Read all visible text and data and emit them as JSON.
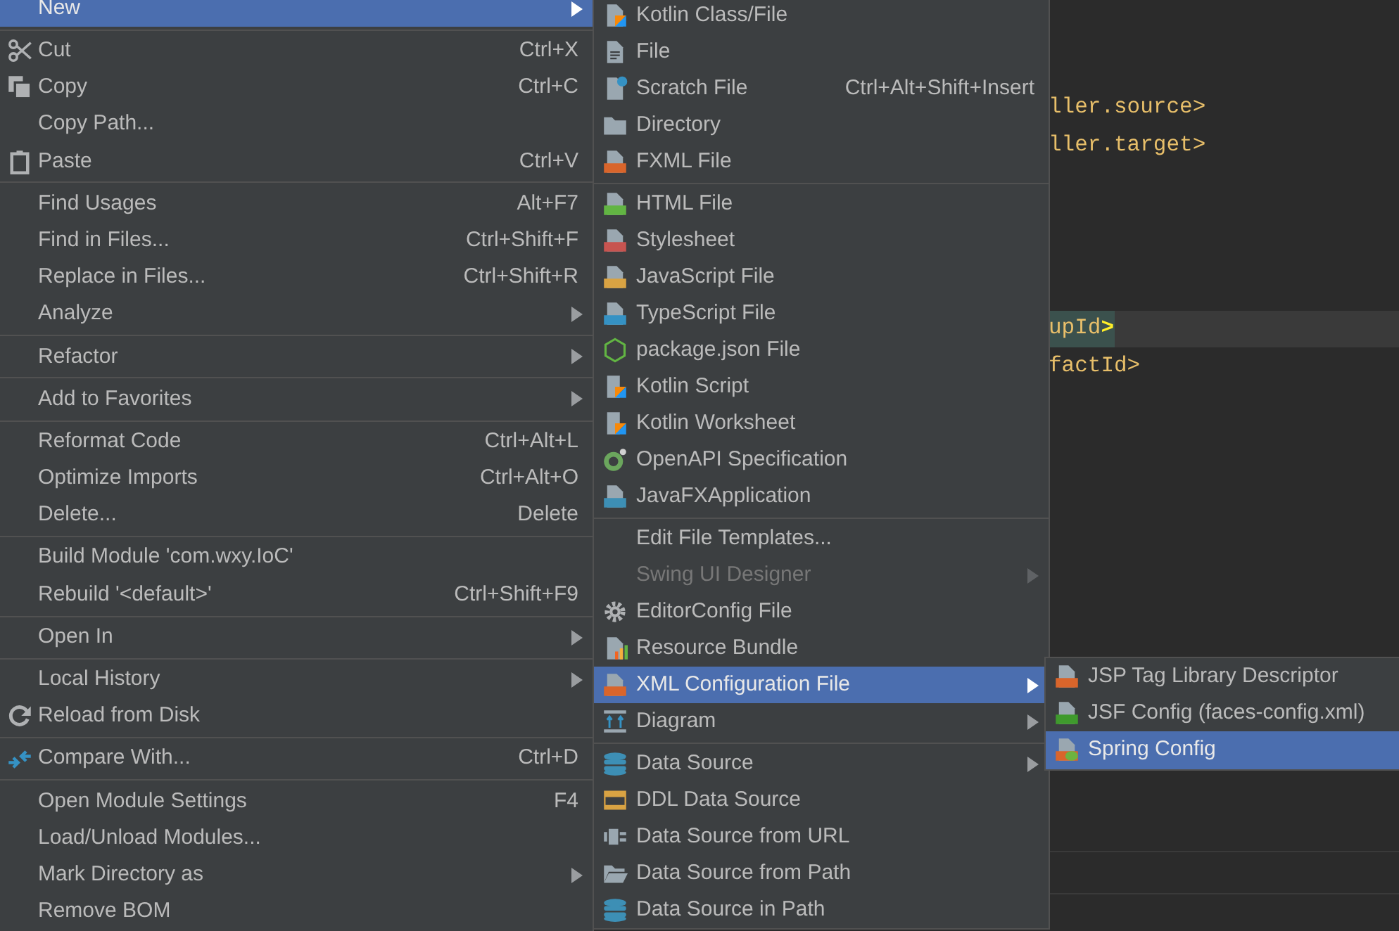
{
  "editor": {
    "blocks": [
      {
        "lines": [
          {
            "segments": [
              {
                "text": "ller.source>",
                "kind": "tag"
              }
            ]
          },
          {
            "segments": [
              {
                "text": "ller.target>",
                "kind": "tag"
              }
            ]
          }
        ]
      },
      {
        "lines": [
          {
            "current": true,
            "segments": [
              {
                "text": "upId",
                "kind": "highlighted-tag"
              },
              {
                "text": ">",
                "kind": "brace"
              }
            ]
          },
          {
            "current": false,
            "segments": [
              {
                "text": "factId>",
                "kind": "tag"
              }
            ]
          }
        ]
      }
    ]
  },
  "left_menu": {
    "groups": [
      [
        {
          "label": "New",
          "submenu": true,
          "selected": true
        }
      ],
      [
        {
          "label": "Cut",
          "shortcut": "Ctrl+X",
          "selected": false
        },
        {
          "label": "Copy",
          "shortcut": "Ctrl+C",
          "selected": false
        },
        {
          "label": "Copy Path...",
          "selected": false
        },
        {
          "label": "Paste",
          "shortcut": "Ctrl+V",
          "selected": false
        }
      ],
      [
        {
          "label": "Find Usages",
          "shortcut": "Alt+F7",
          "selected": false
        },
        {
          "label": "Find in Files...",
          "shortcut": "Ctrl+Shift+F",
          "selected": false
        },
        {
          "label": "Replace in Files...",
          "shortcut": "Ctrl+Shift+R",
          "selected": false
        },
        {
          "label": "Analyze",
          "submenu": true,
          "selected": false
        }
      ],
      [
        {
          "label": "Refactor",
          "submenu": true,
          "selected": false
        }
      ],
      [
        {
          "label": "Add to Favorites",
          "submenu": true,
          "selected": false
        }
      ],
      [
        {
          "label": "Reformat Code",
          "shortcut": "Ctrl+Alt+L",
          "selected": false
        },
        {
          "label": "Optimize Imports",
          "shortcut": "Ctrl+Alt+O",
          "selected": false
        },
        {
          "label": "Delete...",
          "shortcut": "Delete",
          "selected": false
        }
      ],
      [
        {
          "label": "Build Module 'com.wxy.IoC'",
          "selected": false
        },
        {
          "label": "Rebuild '<default>'",
          "shortcut": "Ctrl+Shift+F9",
          "selected": false
        }
      ],
      [
        {
          "label": "Open In",
          "submenu": true,
          "selected": false
        }
      ],
      [
        {
          "label": "Local History",
          "submenu": true,
          "selected": false
        },
        {
          "label": "Reload from Disk",
          "selected": false
        }
      ],
      [
        {
          "label": "Compare With...",
          "shortcut": "Ctrl+D",
          "selected": false
        }
      ],
      [
        {
          "label": "Open Module Settings",
          "shortcut": "F4",
          "selected": false
        },
        {
          "label": "Load/Unload Modules...",
          "selected": false
        },
        {
          "label": "Mark Directory as",
          "submenu": true,
          "selected": false
        },
        {
          "label": "Remove BOM",
          "selected": false
        }
      ]
    ]
  },
  "new_menu": {
    "groups": [
      [
        {
          "label": "Kotlin Class/File",
          "selected": false
        },
        {
          "label": "File",
          "selected": false
        },
        {
          "label": "Scratch File",
          "shortcut": "Ctrl+Alt+Shift+Insert",
          "selected": false
        },
        {
          "label": "Directory",
          "selected": false
        },
        {
          "label": "FXML File",
          "selected": false
        }
      ],
      [
        {
          "label": "HTML File",
          "selected": false
        },
        {
          "label": "Stylesheet",
          "selected": false
        },
        {
          "label": "JavaScript File",
          "selected": false
        },
        {
          "label": "TypeScript File",
          "selected": false
        },
        {
          "label": "package.json File",
          "selected": false
        },
        {
          "label": "Kotlin Script",
          "selected": false
        },
        {
          "label": "Kotlin Worksheet",
          "selected": false
        },
        {
          "label": "OpenAPI Specification",
          "selected": false
        },
        {
          "label": "JavaFXApplication",
          "selected": false
        }
      ],
      [
        {
          "label": "Edit File Templates...",
          "selected": false
        },
        {
          "label": "Swing UI Designer",
          "submenu": true,
          "disabled": true,
          "selected": false
        },
        {
          "label": "EditorConfig File",
          "selected": false
        },
        {
          "label": "Resource Bundle",
          "selected": false
        },
        {
          "label": "XML Configuration File",
          "submenu": true,
          "selected": true
        },
        {
          "label": "Diagram",
          "submenu": true,
          "selected": false
        }
      ],
      [
        {
          "label": "Data Source",
          "submenu": true,
          "selected": false
        },
        {
          "label": "DDL Data Source",
          "selected": false
        },
        {
          "label": "Data Source from URL",
          "selected": false
        },
        {
          "label": "Data Source from Path",
          "selected": false
        },
        {
          "label": "Data Source in Path",
          "selected": false
        }
      ]
    ]
  },
  "xml_menu": {
    "groups": [
      [
        {
          "label": "JSP Tag Library Descriptor",
          "selected": false
        },
        {
          "label": "JSF Config (faces-config.xml)",
          "selected": false
        },
        {
          "label": "Spring Config",
          "selected": true
        }
      ]
    ]
  }
}
